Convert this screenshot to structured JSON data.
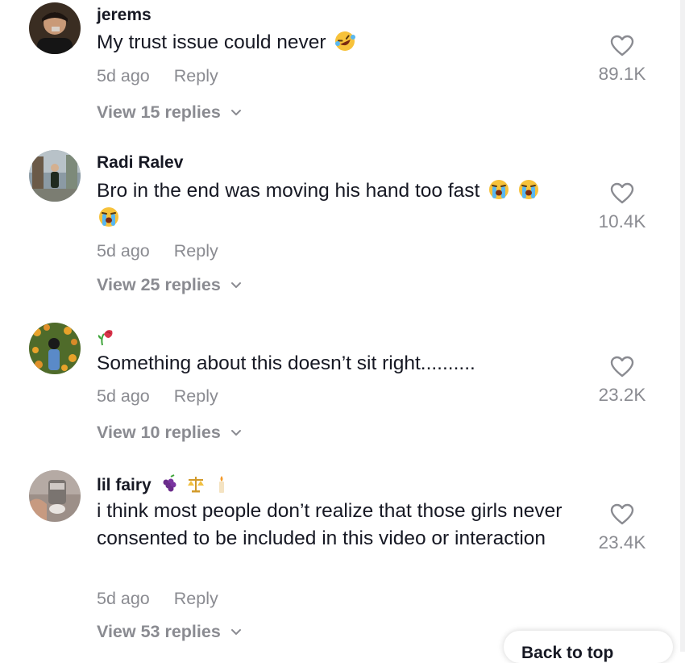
{
  "comments": [
    {
      "username": "jerems",
      "username_emojis": [],
      "text": "My trust issue could never",
      "text_emojis": [
        "rofl-face-emoji"
      ],
      "time": "5d ago",
      "reply_label": "Reply",
      "view_replies": "View 15 replies",
      "likes": "89.1K",
      "avatar": "person-in-dark-hoodie"
    },
    {
      "username": "Radi Ralev",
      "username_emojis": [],
      "text": "Bro in the end was moving his hand too fast",
      "text_emojis": [
        "crying-face-emoji",
        "crying-face-emoji",
        "crying-face-emoji"
      ],
      "time": "5d ago",
      "reply_label": "Reply",
      "view_replies": "View 25 replies",
      "likes": "10.4K",
      "avatar": "person-standing-outdoors"
    },
    {
      "username": "",
      "username_emojis": [
        "wilted-flower-emoji"
      ],
      "text": "Something about this doesn’t sit right..........",
      "text_emojis": [],
      "time": "5d ago",
      "reply_label": "Reply",
      "view_replies": "View 10 replies",
      "likes": "23.2K",
      "avatar": "person-in-flower-field"
    },
    {
      "username": "lil fairy",
      "username_emojis": [
        "grapes-emoji",
        "balance-scale-emoji",
        "candle-emoji"
      ],
      "text": "i think most people don’t realize that those girls never consented to be included in this video or interaction",
      "text_emojis": [],
      "time": "5d ago",
      "reply_label": "Reply",
      "view_replies": "View 53 replies",
      "likes": "23.4K",
      "avatar": "candle-jar-photo"
    }
  ],
  "back_to_top_label": "Back to top",
  "colors": {
    "primary_text": "#161823",
    "secondary_text": "#8a8b91",
    "background": "#ffffff"
  }
}
